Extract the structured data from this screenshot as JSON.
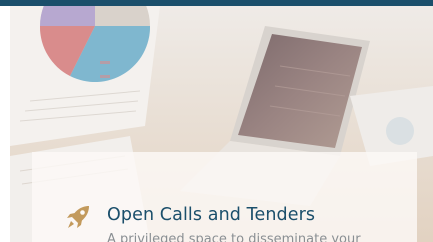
{
  "card": {
    "icon": "rocket-icon",
    "title": "Open Calls and Tenders",
    "description": "A privileged space to disseminate your"
  },
  "colors": {
    "top_bar": "#1b4f6b",
    "title": "#1b4f6b",
    "icon": "#c39a5c",
    "description": "#8a8f93"
  }
}
